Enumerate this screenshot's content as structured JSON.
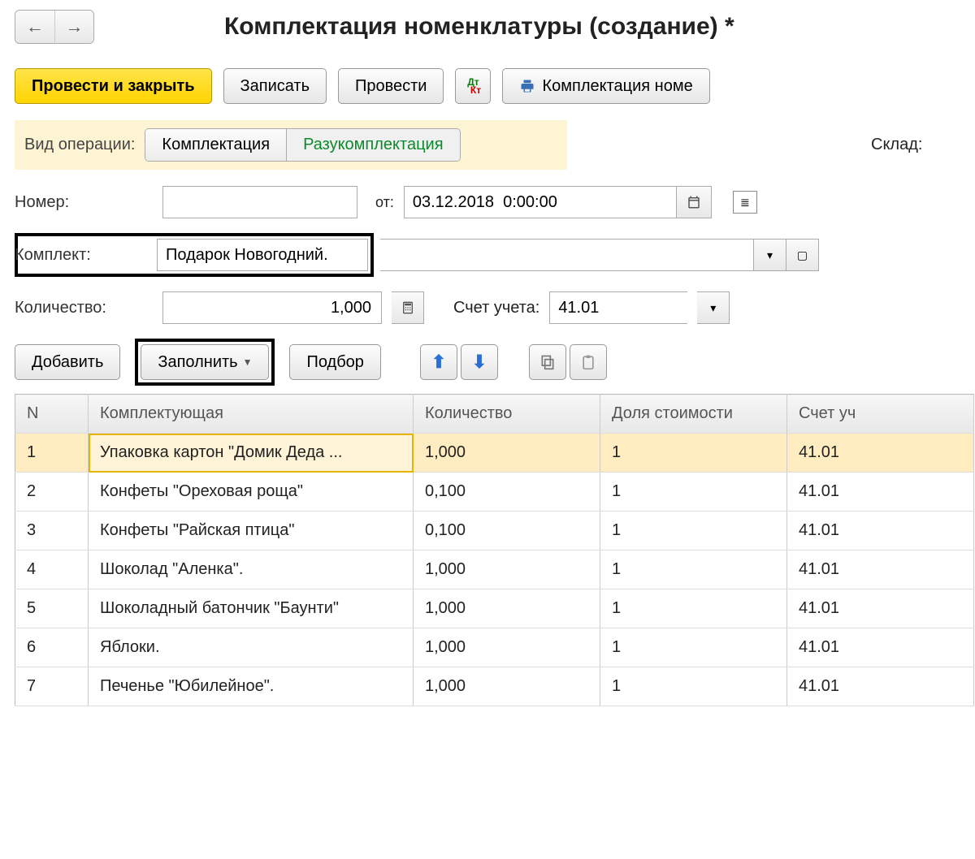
{
  "nav": {
    "back": "←",
    "forward": "→"
  },
  "title": "Комплектация номенклатуры (создание) *",
  "toolbar": {
    "post_close": "Провести и закрыть",
    "save": "Записать",
    "post": "Провести",
    "print_label": "Комплектация номе"
  },
  "op": {
    "label": "Вид операции:",
    "option1": "Комплектация",
    "option2": "Разукомплектация"
  },
  "sklad": {
    "label": "Склад:"
  },
  "form": {
    "number_label": "Номер:",
    "number_value": "",
    "date_label": "от:",
    "date_value": "03.12.2018  0:00:00",
    "set_label": "Комплект:",
    "set_value": "Подарок Новогодний.",
    "qty_label": "Количество:",
    "qty_value": "1,000",
    "acct_label": "Счет учета:",
    "acct_value": "41.01"
  },
  "table_toolbar": {
    "add": "Добавить",
    "fill": "Заполнить",
    "select": "Подбор"
  },
  "table": {
    "headers": {
      "n": "N",
      "item": "Комплектующая",
      "qty": "Количество",
      "share": "Доля стоимости",
      "acct": "Счет уч"
    },
    "rows": [
      {
        "n": "1",
        "item": "Упаковка картон \"Домик Деда ...",
        "qty": "1,000",
        "share": "1",
        "acct": "41.01",
        "selected": true
      },
      {
        "n": "2",
        "item": "Конфеты \"Ореховая роща\"",
        "qty": "0,100",
        "share": "1",
        "acct": "41.01"
      },
      {
        "n": "3",
        "item": "Конфеты \"Райская птица\"",
        "qty": "0,100",
        "share": "1",
        "acct": "41.01"
      },
      {
        "n": "4",
        "item": "Шоколад \"Аленка\".",
        "qty": "1,000",
        "share": "1",
        "acct": "41.01"
      },
      {
        "n": "5",
        "item": "Шоколадный батончик \"Баунти\"",
        "qty": "1,000",
        "share": "1",
        "acct": "41.01"
      },
      {
        "n": "6",
        "item": "Яблоки.",
        "qty": "1,000",
        "share": "1",
        "acct": "41.01"
      },
      {
        "n": "7",
        "item": "Печенье \"Юбилейное\".",
        "qty": "1,000",
        "share": "1",
        "acct": "41.01"
      }
    ]
  }
}
